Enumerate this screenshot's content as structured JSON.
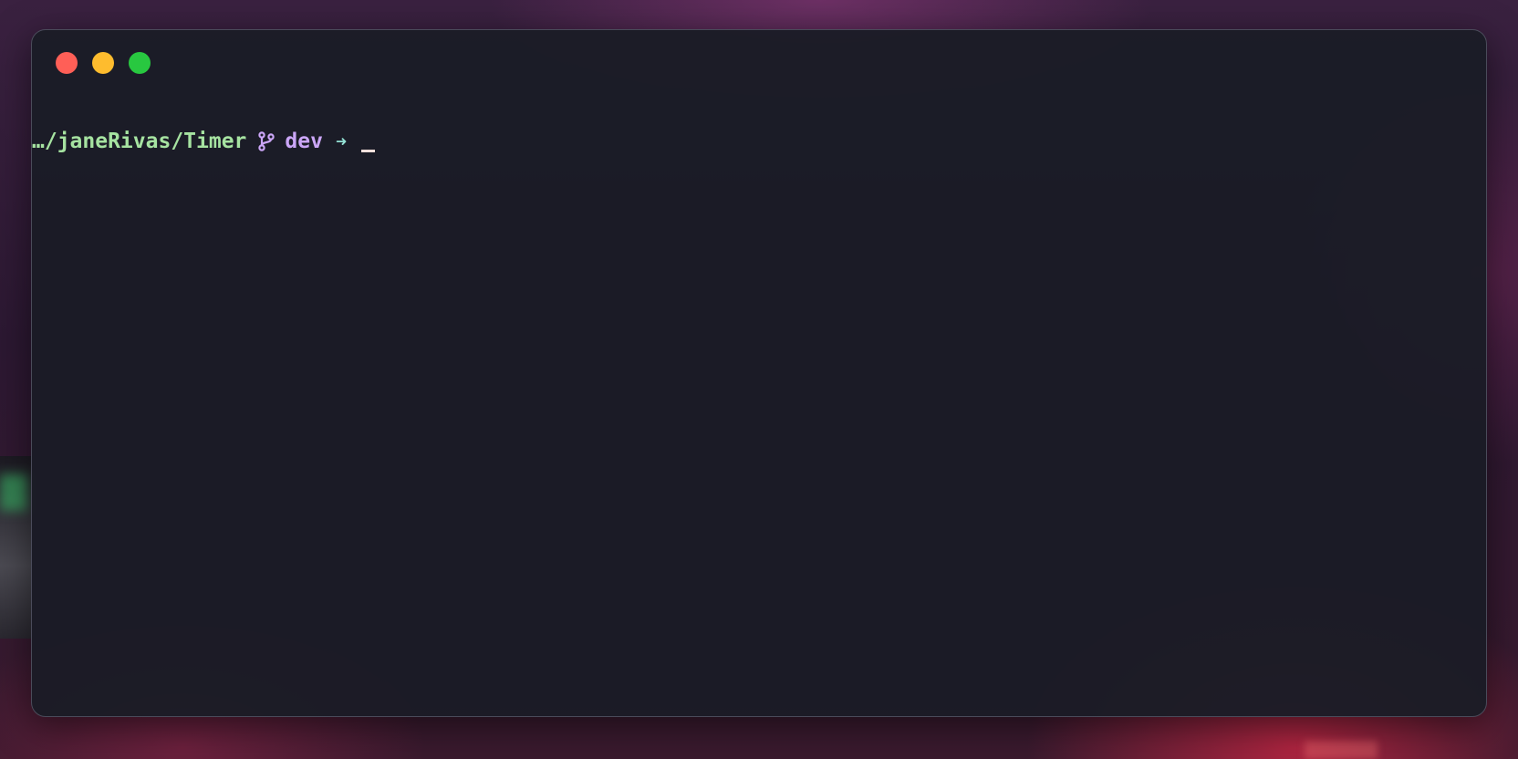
{
  "terminal": {
    "prompt": {
      "path": "…/janeRivas/Timer",
      "branch": "dev",
      "arrow": "➜"
    }
  },
  "icons": {
    "branch": "git-branch-icon",
    "cursor": "block-cursor"
  },
  "colors": {
    "close": "#ff5f57",
    "minimize": "#febc2e",
    "maximize": "#28c840",
    "path": "#a6e3a1",
    "branch": "#cba6f7",
    "arrow": "#94e2d5",
    "window_bg": "#1b1c26"
  }
}
